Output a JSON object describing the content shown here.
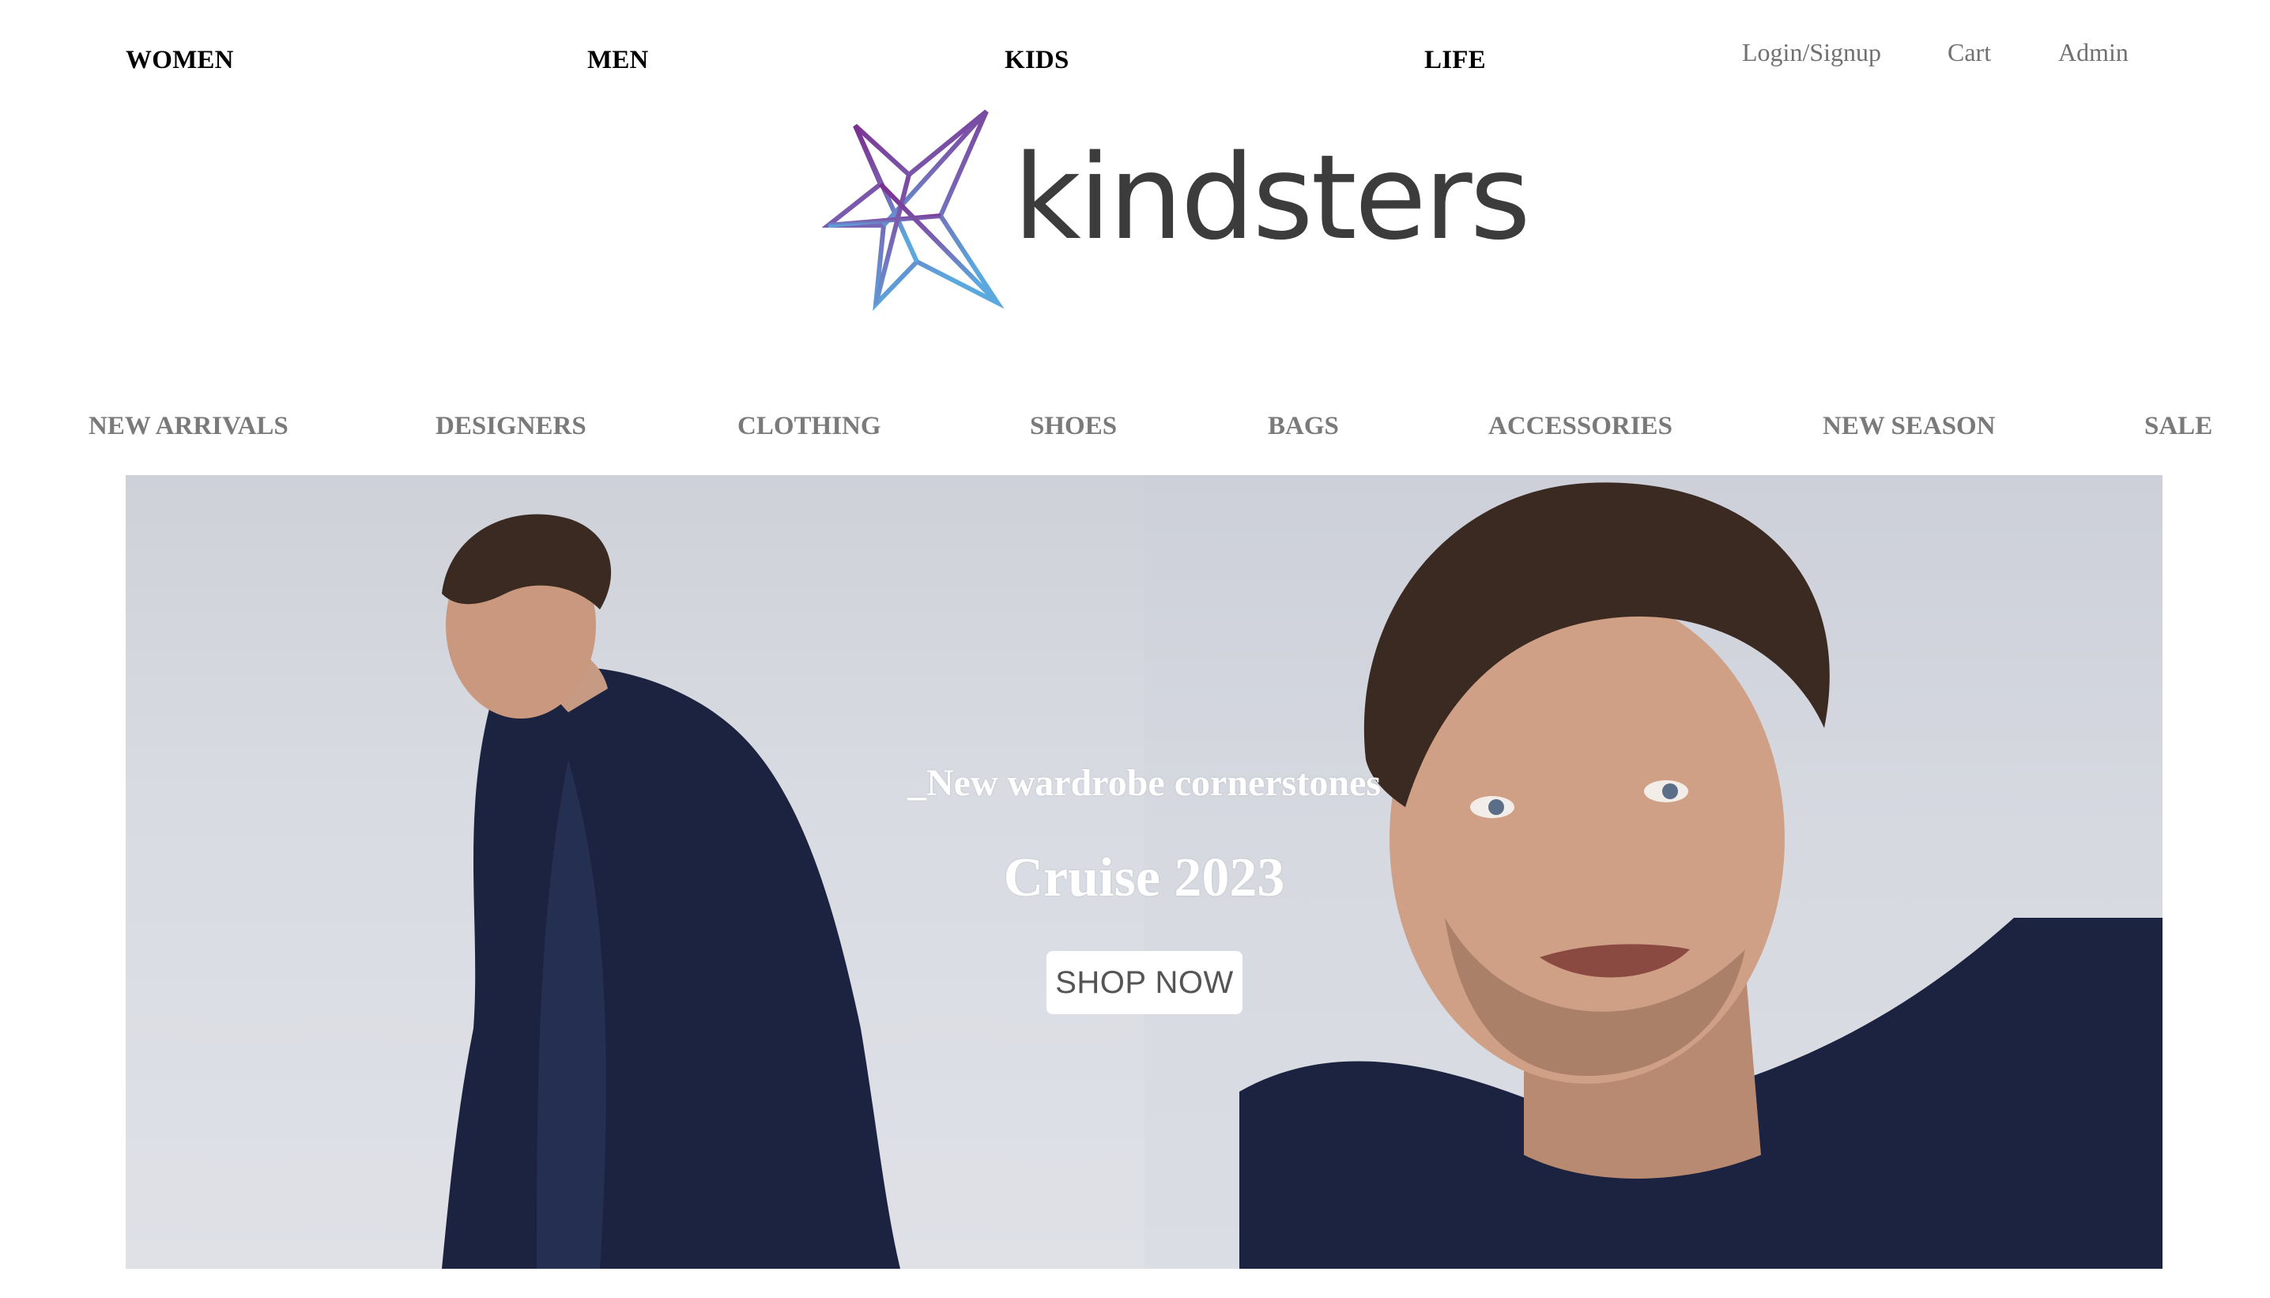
{
  "top_nav": {
    "genders": [
      "WOMEN",
      "MEN",
      "KIDS",
      "LIFE"
    ],
    "utility": [
      "Login/Signup",
      "Cart",
      "Admin"
    ]
  },
  "logo": {
    "wordmark": "kindsters",
    "star_icon": "star-logo-icon",
    "text_color": "#3c3c3c",
    "gradient_colors": [
      "#7b2d8e",
      "#5aa8de"
    ]
  },
  "categories": [
    "NEW ARRIVALS",
    "DESIGNERS",
    "CLOTHING",
    "SHOES",
    "BAGS",
    "ACCESSORIES",
    "NEW SEASON",
    "SALE"
  ],
  "hero": {
    "subtitle": "_New wardrobe cornerstones",
    "title": "Cruise 2023",
    "cta_label": "SHOP NOW",
    "coat_color": "#1c2340"
  }
}
